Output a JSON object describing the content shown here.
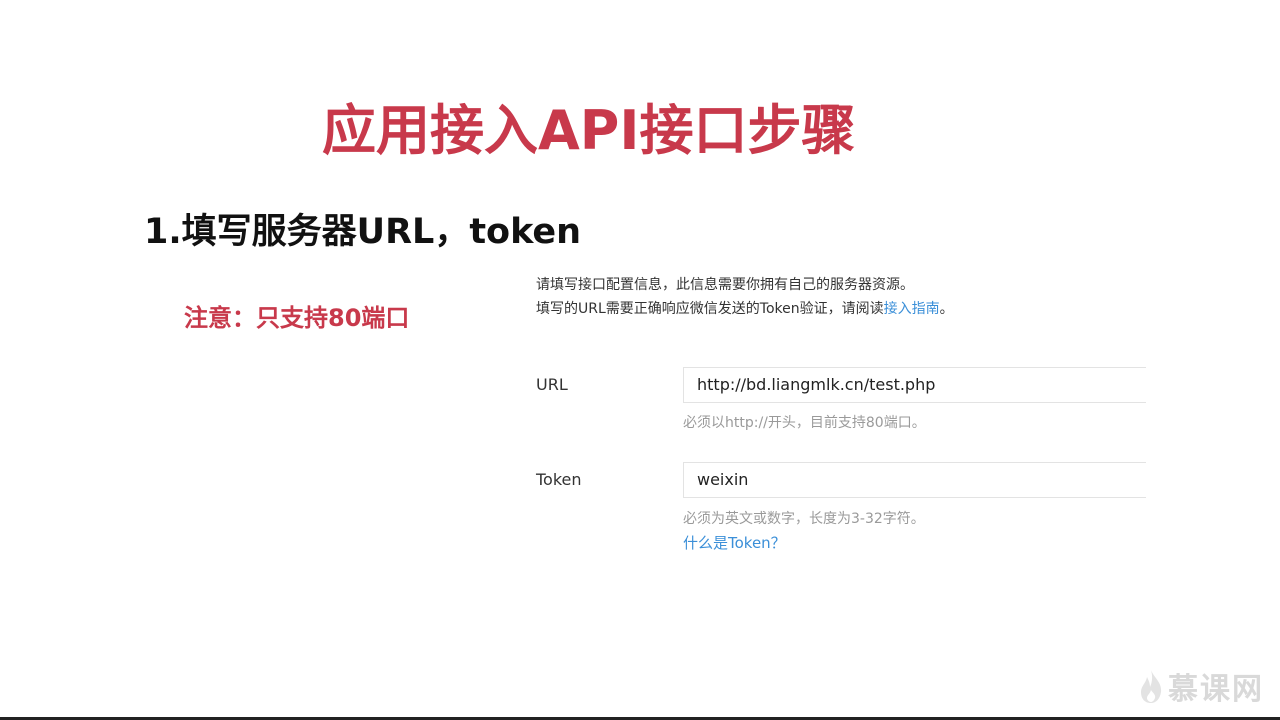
{
  "slide": {
    "title": "应用接入API接口步骤",
    "step_heading": "1.填写服务器URL，token",
    "note": "注意：只支持80端口"
  },
  "config_panel": {
    "intro_line1": "请填写接口配置信息，此信息需要你拥有自己的服务器资源。",
    "intro_line2_prefix": "填写的URL需要正确响应微信发送的Token验证，请阅读",
    "intro_line2_link": "接入指南",
    "intro_line2_suffix": "。",
    "url_label": "URL",
    "url_value": "http://bd.liangmlk.cn/test.php",
    "url_hint": "必须以http://开头，目前支持80端口。",
    "token_label": "Token",
    "token_value": "weixin",
    "token_hint": "必须为英文或数字，长度为3-32字符。",
    "token_help_link": "什么是Token？"
  },
  "watermark": {
    "text": "慕课网",
    "icon": "flame-icon"
  },
  "colors": {
    "accent_red": "#c8394b",
    "link_blue": "#3b8fd8",
    "hint_gray": "#9a9a9a"
  }
}
